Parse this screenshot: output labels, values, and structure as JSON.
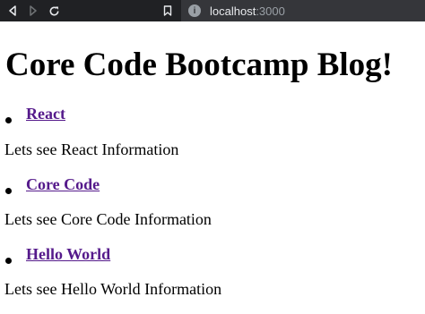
{
  "browser": {
    "url_host": "localhost",
    "url_port": ":3000",
    "info_icon": "i"
  },
  "page": {
    "title": "Core Code Bootcamp Blog!",
    "items": [
      {
        "link": "React",
        "description": "Lets see React Information"
      },
      {
        "link": "Core Code",
        "description": "Lets see Core Code Information"
      },
      {
        "link": "Hello World",
        "description": "Lets see Hello World Information"
      }
    ]
  },
  "colors": {
    "toolbar": "#202124",
    "omnibox": "#35363a",
    "link_visited": "#551a8b"
  }
}
